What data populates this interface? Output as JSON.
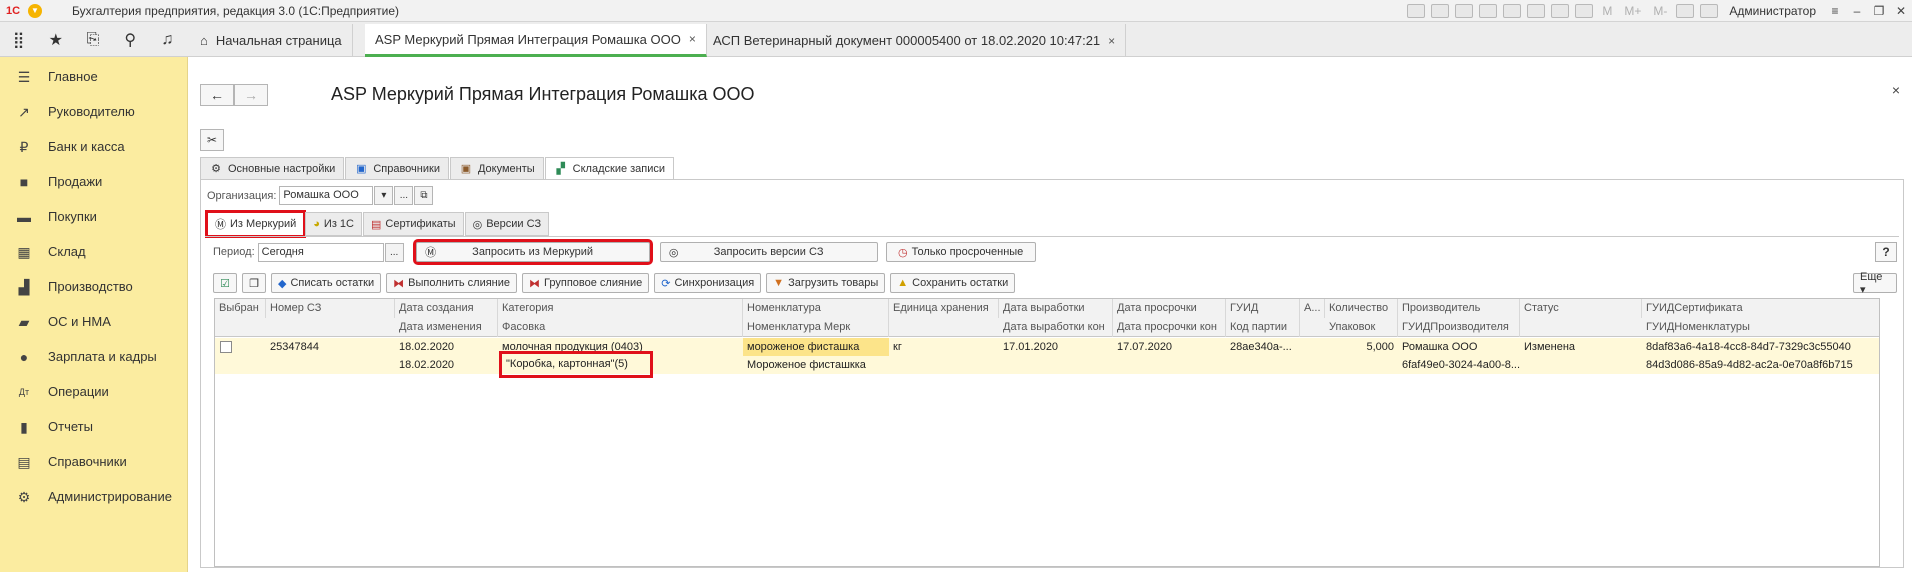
{
  "titlebar": {
    "title": "Бухгалтерия предприятия, редакция 3.0  (1С:Предприятие)",
    "logo": "1С",
    "m_labels": [
      "M",
      "M+",
      "M-"
    ],
    "user": "Администратор"
  },
  "tabs": [
    {
      "label": "Начальная страница",
      "icon": "home-icon"
    },
    {
      "label": "ASP Меркурий Прямая Интеграция Ромашка ООО",
      "close": "×"
    },
    {
      "label": "АСП Ветеринарный документ 000005400 от 18.02.2020 10:47:21",
      "close": "×"
    }
  ],
  "sidebar": {
    "items": [
      {
        "label": "Главное",
        "icon": "menu-lines-icon"
      },
      {
        "label": "Руководителю",
        "icon": "trend-icon"
      },
      {
        "label": "Банк и касса",
        "icon": "ruble-icon"
      },
      {
        "label": "Продажи",
        "icon": "bag-icon"
      },
      {
        "label": "Покупки",
        "icon": "cart-icon"
      },
      {
        "label": "Склад",
        "icon": "warehouse-icon"
      },
      {
        "label": "Производство",
        "icon": "factory-icon"
      },
      {
        "label": "ОС и НМА",
        "icon": "truck-icon"
      },
      {
        "label": "Зарплата и кадры",
        "icon": "person-icon"
      },
      {
        "label": "Операции",
        "icon": "dt-kt-icon"
      },
      {
        "label": "Отчеты",
        "icon": "chart-icon"
      },
      {
        "label": "Справочники",
        "icon": "book-icon"
      },
      {
        "label": "Администрирование",
        "icon": "gear-icon"
      }
    ]
  },
  "doc": {
    "title": "ASP Меркурий Прямая Интеграция Ромашка ООО",
    "close": "×"
  },
  "main_tabs": [
    {
      "label": "Основные настройки"
    },
    {
      "label": "Справочники"
    },
    {
      "label": "Документы"
    },
    {
      "label": "Складские записи"
    }
  ],
  "org": {
    "label": "Организация:",
    "value": "Ромашка ООО",
    "select_btn": "▾",
    "dots_btn": "...",
    "open_btn": "⧉"
  },
  "sub_tabs": [
    {
      "label": "Из Меркурий"
    },
    {
      "label": "Из 1С"
    },
    {
      "label": "Сертификаты"
    },
    {
      "label": "Версии СЗ"
    }
  ],
  "period": {
    "label": "Период:",
    "value": "Сегодня",
    "dots_btn": "..."
  },
  "buttons": {
    "request_mercury": "Запросить из Меркурий",
    "request_versions": "Запросить версии СЗ",
    "only_expired": "Только просроченные",
    "help": "?",
    "more": "Еще ▾"
  },
  "actions": [
    {
      "label": "Списать остатки"
    },
    {
      "label": "Выполнить слияние"
    },
    {
      "label": "Групповое слияние"
    },
    {
      "label": "Синхронизация"
    },
    {
      "label": "Загрузить товары"
    },
    {
      "label": "Сохранить остатки"
    }
  ],
  "table": {
    "headers_row1": [
      "Выбран",
      "Номер СЗ",
      "Дата создания",
      "Категория",
      "Номенклатура",
      "Единица хранения",
      "Дата выработки",
      "Дата просрочки",
      "ГУИД",
      "А...",
      "Количество",
      "Производитель",
      "Статус",
      "ГУИДСертификата"
    ],
    "headers_row2": [
      "",
      "",
      "Дата изменения",
      "Фасовка",
      "Номенклатура Мерк",
      "",
      "Дата выработки кон",
      "Дата просрочки кон",
      "Код партии",
      "",
      "Упаковок",
      "ГУИДПроизводителя",
      "",
      "ГУИДНоменклатуры"
    ],
    "row1": [
      "",
      "25347844",
      "18.02.2020",
      "молочная продукция (0403)",
      "мороженое фисташка",
      "кг",
      "17.01.2020",
      "17.07.2020",
      "28ae340a-...",
      "",
      "5,000",
      "Ромашка ООО",
      "Изменена",
      "8daf83a6-4a18-4cc8-84d7-7329c3c55040"
    ],
    "row2": [
      "",
      "",
      "18.02.2020",
      "\"Коробка, картонная\"(5)",
      "Мороженое фисташкка",
      "",
      "",
      "",
      "",
      "",
      "",
      "6faf49e0-3024-4a00-8...",
      "",
      "84d3d086-85a9-4d82-ac2a-0e70a8f6b715"
    ]
  },
  "colors": {
    "sidebar_bg": "#fbeca0",
    "highlight_red": "#e0101a",
    "row_bg": "#fff9d9",
    "active_tab_accent": "#4caf50"
  }
}
